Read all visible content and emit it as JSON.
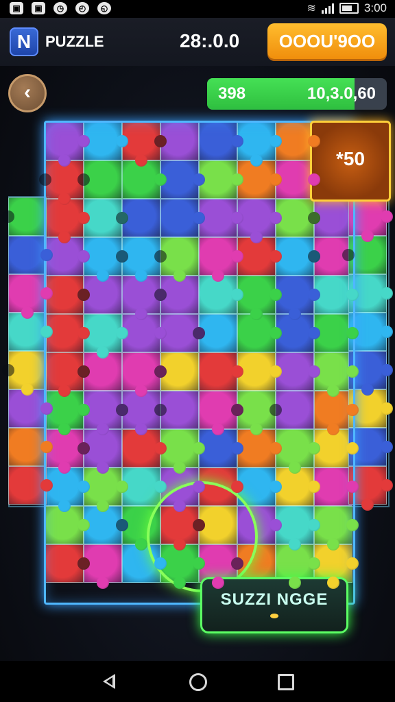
{
  "status_bar": {
    "time": "3:00",
    "left_icons": [
      "image-icon",
      "image-icon",
      "clock-icon",
      "alarm-icon",
      "clock-icon"
    ]
  },
  "header": {
    "app_logo": "N",
    "title": "PUZZLE",
    "score": "28:.0.0",
    "coin_button": "OOOU'9OO"
  },
  "progress": {
    "left_value": "398",
    "right_value": "10,3.0,60",
    "fill_fraction": 0.82,
    "fill_color": "#3fd14d"
  },
  "reward_tile": {
    "label": "*50"
  },
  "hint_button": {
    "label": "SUZZI NGGE"
  },
  "colors": {
    "accent_green": "#5cff64",
    "board_glow": "#4fb7ff",
    "coin_orange": "#f5a01c",
    "reward_gold": "#ffcf3a"
  },
  "board_palette": [
    "#e33a3a",
    "#3bd149",
    "#2fb6f0",
    "#f2d12c",
    "#9a4fd6",
    "#f07c22",
    "#3a5fd8",
    "#e03cb0",
    "#46d8c8",
    "#79e04a"
  ]
}
